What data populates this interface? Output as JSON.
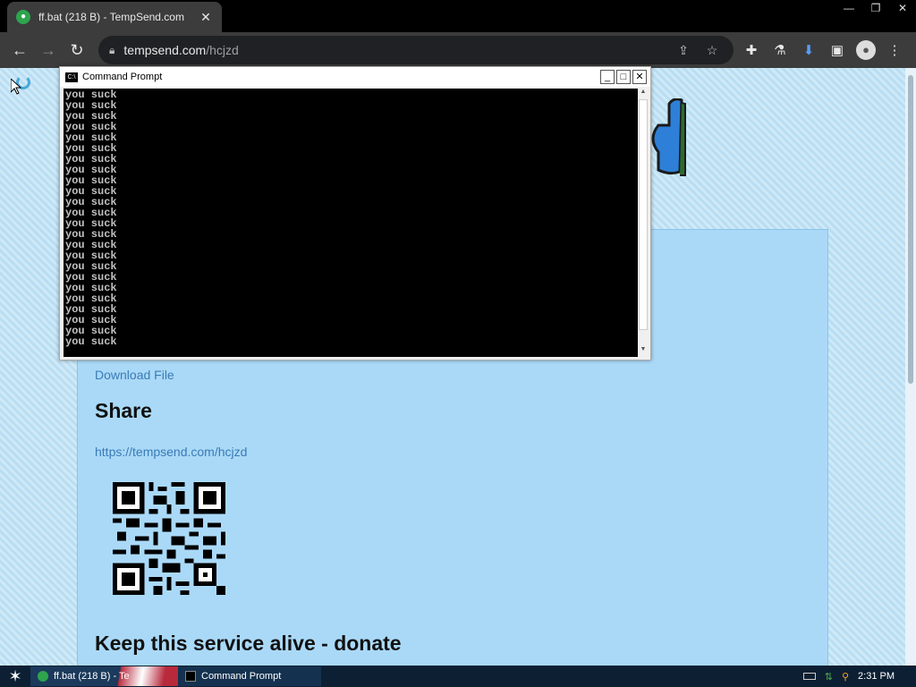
{
  "browser": {
    "tab_title": "ff.bat (218 B) - TempSend.com",
    "tab_close": "✕",
    "newtab": "",
    "window_controls": [
      "—",
      "❐",
      "✕"
    ],
    "nav": {
      "back": "←",
      "forward": "→",
      "reload": "↻"
    },
    "url_host": "tempsend.com",
    "url_path": "/hcjzd",
    "icons": [
      "share-icon",
      "star-icon",
      "extensions-icon",
      "labs-icon",
      "download-icon",
      "sidepanel-icon",
      "profile-icon",
      "menu-icon"
    ]
  },
  "page": {
    "download_link": "Download File",
    "share_heading": "Share",
    "share_url": "https://tempsend.com/hcjzd",
    "donate_heading": "Keep this service alive - donate"
  },
  "cmd": {
    "title": "Command Prompt",
    "buttons": [
      "_",
      "□",
      "✕"
    ],
    "lines": [
      "you suck",
      "you suck",
      "you suck",
      "you suck",
      "you suck",
      "you suck",
      "you suck",
      "you suck",
      "you suck",
      "you suck",
      "you suck",
      "you suck",
      "you suck",
      "you suck",
      "you suck",
      "you suck",
      "you suck",
      "you suck",
      "you suck",
      "you suck",
      "you suck",
      "you suck",
      "you suck",
      "you suck"
    ]
  },
  "taskbar": {
    "start": "✶",
    "tasks": [
      {
        "label": "ff.bat (218 B) - Te"
      },
      {
        "label": "Command Prompt"
      }
    ],
    "clock": "2:31 PM"
  },
  "colors": {
    "link": "#3a7bb5",
    "card": "#aad9f8",
    "download_accent": "#5b9cf5"
  }
}
